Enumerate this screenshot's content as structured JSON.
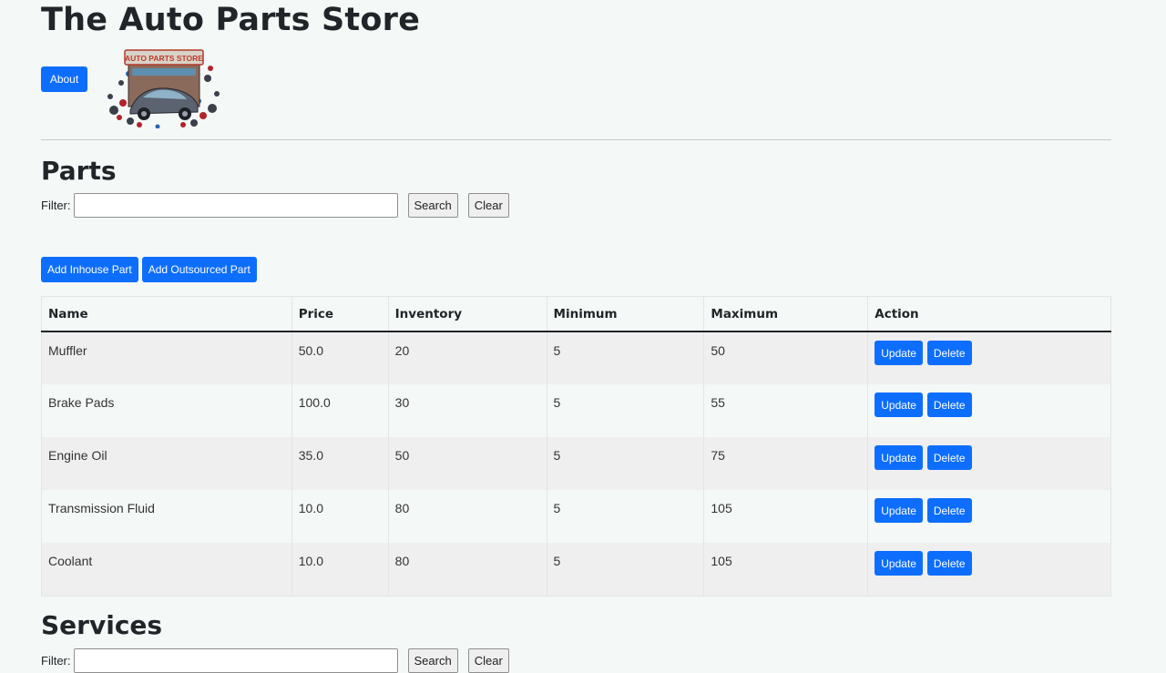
{
  "header": {
    "title": "The Auto Parts Store",
    "about_label": "About",
    "logo_text": "AUTO PARTS STORE"
  },
  "parts": {
    "heading": "Parts",
    "filter_label": "Filter:",
    "filter_value": "",
    "search_label": "Search",
    "clear_label": "Clear",
    "add_inhouse_label": "Add Inhouse Part",
    "add_outsourced_label": "Add Outsourced Part",
    "columns": [
      "Name",
      "Price",
      "Inventory",
      "Minimum",
      "Maximum",
      "Action"
    ],
    "rows": [
      {
        "name": "Muffler",
        "price": "50.0",
        "inventory": "20",
        "minimum": "5",
        "maximum": "50"
      },
      {
        "name": "Brake Pads",
        "price": "100.0",
        "inventory": "30",
        "minimum": "5",
        "maximum": "55"
      },
      {
        "name": "Engine Oil",
        "price": "35.0",
        "inventory": "50",
        "minimum": "5",
        "maximum": "75"
      },
      {
        "name": "Transmission Fluid",
        "price": "10.0",
        "inventory": "80",
        "minimum": "5",
        "maximum": "105"
      },
      {
        "name": "Coolant",
        "price": "10.0",
        "inventory": "80",
        "minimum": "5",
        "maximum": "105"
      }
    ],
    "update_label": "Update",
    "delete_label": "Delete"
  },
  "services": {
    "heading": "Services",
    "filter_label": "Filter:",
    "filter_value": "",
    "search_label": "Search",
    "clear_label": "Clear"
  },
  "colors": {
    "primary": "#0d6efd",
    "background": "#f4f8f6",
    "stripe": "#efefef"
  }
}
